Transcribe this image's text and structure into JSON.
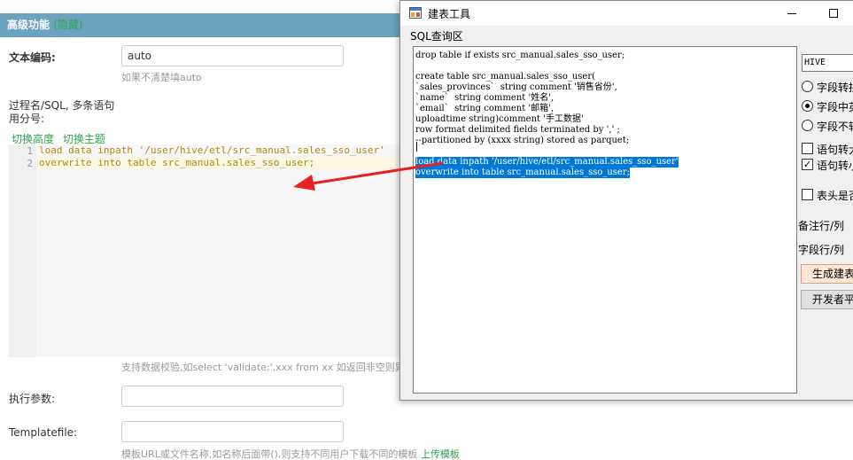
{
  "page": {
    "panel_title": "高级功能",
    "panel_title_link": "(隐藏)",
    "encoding_label": "文本编码:",
    "encoding_value": "auto",
    "encoding_hint": "如果不清楚填auto",
    "sql_label_line1": "过程名/SQL, 多条语句",
    "sql_label_line2": "用分号:",
    "toggle_height": "切换高度",
    "toggle_theme": "切换主题",
    "editor": {
      "line_numbers": [
        "1",
        "2"
      ]
    },
    "validate_hint": "支持数据校验,如select 'validate:',xxx from xx 如返回非空则异",
    "exec_params_label": "执行参数:",
    "exec_params_value": "",
    "templatefile_label": "Templatefile:",
    "templatefile_value": "",
    "template_hint": "模板URL或文件名称,如名称后面带(),则支持不同用户下载不同的模板",
    "upload_template_link": "上传模板"
  },
  "dialog": {
    "title": "建表工具",
    "group_label": "SQL查询区",
    "sql_lines": [
      "drop table if exists src_manual.sales_sso_user;",
      "",
      "create table src_manual.sales_sso_user(",
      "`sales_provinces`  string comment '销售省份',",
      "`name`  string comment '姓名',",
      "`email`  string comment '邮箱',",
      "uploadtime string)comment '手工数据'",
      "row format delimited fields terminated by ',' ;",
      "--partitioned by (xxxx string) stored as parquet;",
      "",
      "load data inpath '/user/hive/etl/src_manual.sales_sso_user'",
      "overwrite into table src_manual.sales_sso_user;"
    ],
    "combo_value": "HIVE",
    "radio_options": [
      "字段转拼",
      "字段中英",
      "字段不转"
    ],
    "radio_selected_index": 1,
    "check_statement_upper": "语句转大",
    "check_statement_lower": "语句转小",
    "check_header": "表头是否",
    "comment_row_label": "备注行/列",
    "field_row_label": "字段行/列",
    "generate_button": "生成建表",
    "dev_platform_button": "开发者平"
  },
  "colors": {
    "panel_header": "#6ca3c0",
    "link_green": "#2ea44f",
    "selection_blue": "#0078d7",
    "arrow_red": "#e8201f"
  }
}
